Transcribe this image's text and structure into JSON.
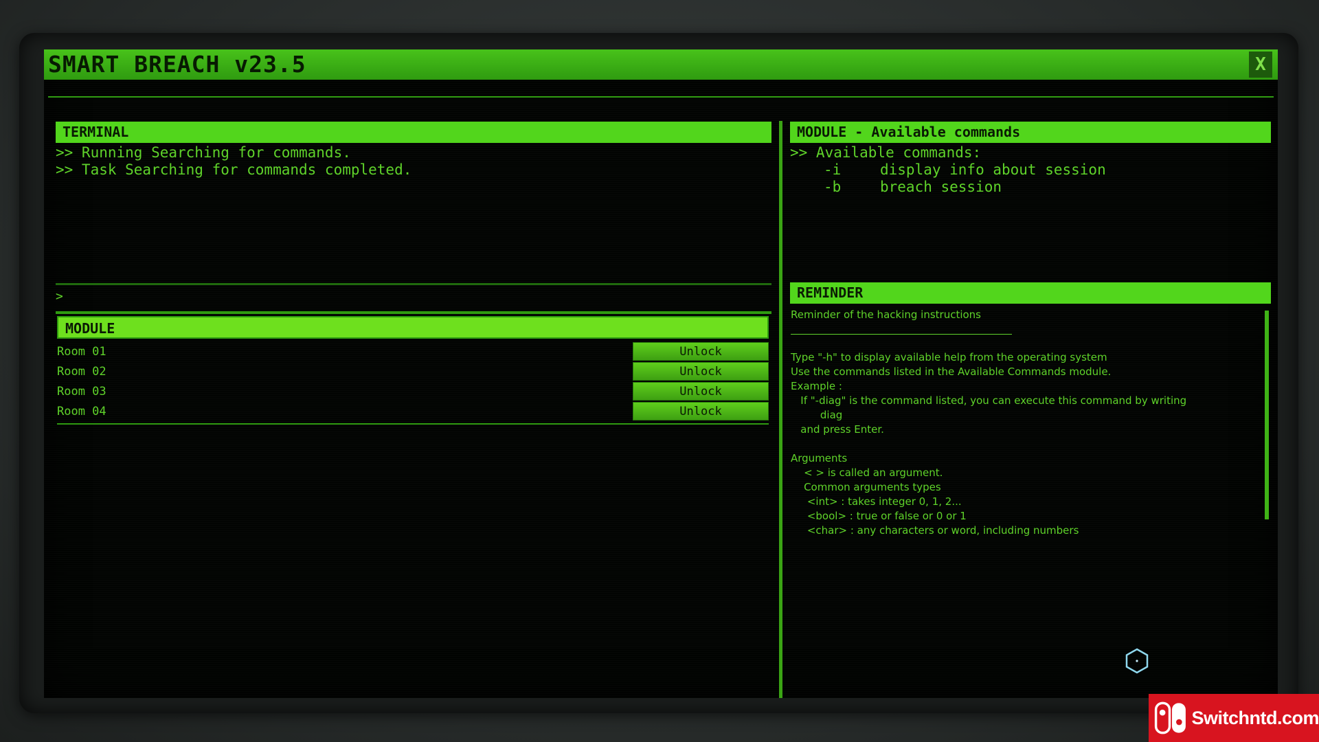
{
  "window": {
    "title": "SMART BREACH v23.5",
    "close_label": "X"
  },
  "terminal": {
    "header": "TERMINAL",
    "lines": [
      ">> Running Searching for commands.",
      ">> Task Searching for commands completed."
    ],
    "prompt": ">"
  },
  "module": {
    "header": "MODULE",
    "rooms": [
      {
        "label": "Room 01",
        "button": "Unlock"
      },
      {
        "label": "Room 02",
        "button": "Unlock"
      },
      {
        "label": "Room 03",
        "button": "Unlock"
      },
      {
        "label": "Room 04",
        "button": "Unlock"
      }
    ]
  },
  "commands": {
    "header": "MODULE - Available commands",
    "intro": ">> Available commands:",
    "list": [
      {
        "flag": "-i",
        "desc": "display info about session"
      },
      {
        "flag": "-b",
        "desc": "breach session"
      }
    ]
  },
  "reminder": {
    "header": "REMINDER",
    "subtitle": "Reminder of the hacking instructions",
    "lines": [
      "Type \"-h\" to display available help from the operating system",
      "Use the commands listed in the Available Commands module.",
      "Example :",
      "   If \"-diag\" is the command listed, you can execute this command by writing",
      "         diag",
      "   and press Enter.",
      "",
      "Arguments",
      "    < > is called an argument.",
      "    Common arguments types",
      "     <int> : takes integer 0, 1, 2...",
      "     <bool> : true or false or 0 or 1",
      "     <char> : any characters or word, including numbers"
    ]
  },
  "watermark": {
    "text": "Switchntd.com"
  },
  "colors": {
    "accent": "#52d61c",
    "text": "#5fd32a",
    "background": "#020402",
    "watermark": "#d8141f"
  }
}
